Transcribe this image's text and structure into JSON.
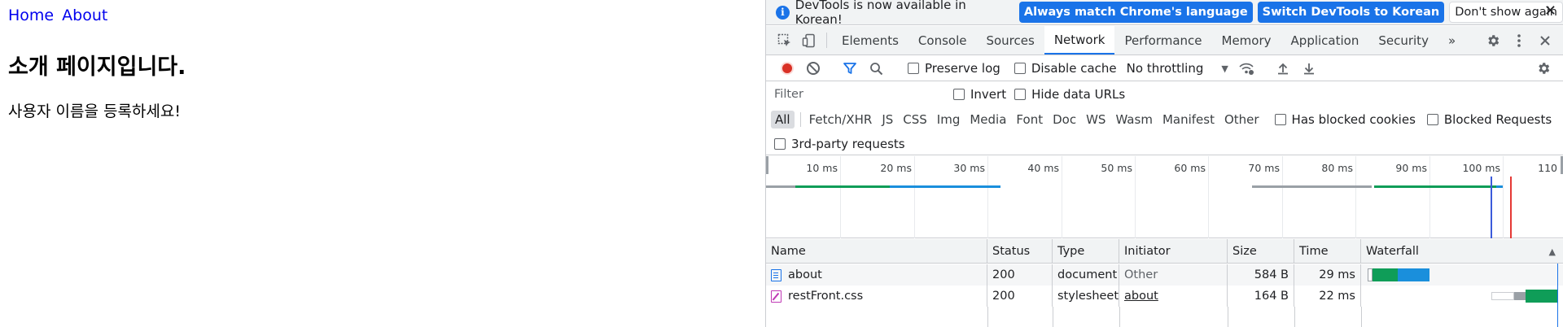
{
  "page": {
    "nav": [
      {
        "label": "Home"
      },
      {
        "label": "About"
      }
    ],
    "heading": "소개 페이지입니다.",
    "text": "사용자 이름을 등록하세요!"
  },
  "infobar": {
    "icon": "info-icon",
    "message": "DevTools is now available in Korean!",
    "btn_match": "Always match Chrome's language",
    "btn_switch": "Switch DevTools to Korean",
    "btn_dont_show": "Don't show again",
    "close": "✕"
  },
  "tabs": {
    "items": [
      "Elements",
      "Console",
      "Sources",
      "Network",
      "Performance",
      "Memory",
      "Application",
      "Security"
    ],
    "active": "Network",
    "more": "»"
  },
  "network_toolbar": {
    "preserve_log": "Preserve log",
    "disable_cache": "Disable cache",
    "throttling": "No throttling"
  },
  "filter": {
    "placeholder": "Filter",
    "invert": "Invert",
    "hide_data_urls": "Hide data URLs"
  },
  "types": {
    "items": [
      "All",
      "Fetch/XHR",
      "JS",
      "CSS",
      "Img",
      "Media",
      "Font",
      "Doc",
      "WS",
      "Wasm",
      "Manifest",
      "Other"
    ],
    "active": "All",
    "has_blocked_cookies": "Has blocked cookies",
    "blocked_requests": "Blocked Requests",
    "third_party": "3rd-party requests"
  },
  "overview": {
    "ticks": [
      "10 ms",
      "20 ms",
      "30 ms",
      "40 ms",
      "50 ms",
      "60 ms",
      "70 ms",
      "80 ms",
      "90 ms",
      "100 ms",
      "110"
    ]
  },
  "table": {
    "headers": {
      "name": "Name",
      "status": "Status",
      "type": "Type",
      "initiator": "Initiator",
      "size": "Size",
      "time": "Time",
      "waterfall": "Waterfall"
    },
    "sort_icon": "▲",
    "rows": [
      {
        "name": "about",
        "status": "200",
        "type": "document",
        "initiator": "Other",
        "size": "584 B",
        "time": "29 ms",
        "icon": "document-icon"
      },
      {
        "name": "restFront.css",
        "status": "200",
        "type": "stylesheet",
        "initiator": "about",
        "size": "164 B",
        "time": "22 ms",
        "icon": "stylesheet-icon"
      }
    ]
  },
  "colors": {
    "accent": "#1a73e8",
    "record": "#d93025",
    "waterfall_green": "#0f9d58",
    "waterfall_blue": "#1a8fdc"
  }
}
